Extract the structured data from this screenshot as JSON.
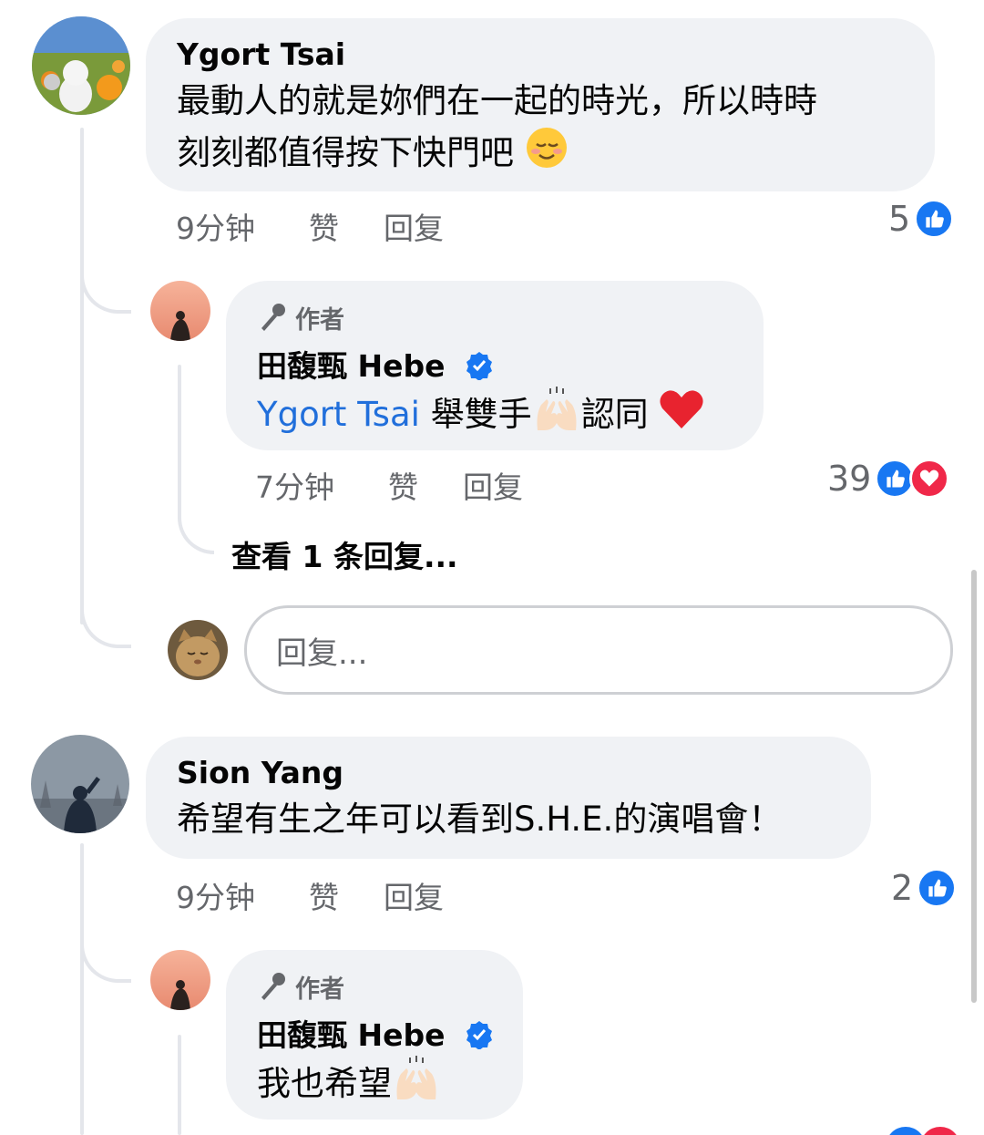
{
  "comments": [
    {
      "name": "Ygort Tsai",
      "text_line1": "最動人的就是妳們在一起的時光，所以時時",
      "text_line2": "刻刻都值得按下快門吧",
      "time": "9分钟",
      "like_label": "赞",
      "reply_label": "回复",
      "reaction_count": "5",
      "reply": {
        "author_tag": "作者",
        "name": "田馥甄 Hebe",
        "mention": "Ygort Tsai",
        "text": "舉雙手",
        "text_after": "認同",
        "time": "7分钟",
        "like_label": "赞",
        "reply_label": "回复",
        "reaction_count": "39"
      },
      "view_replies": "查看 1 条回复...",
      "reply_placeholder": "回复..."
    },
    {
      "name": "Sion Yang",
      "text": "希望有生之年可以看到S.H.E.的演唱會！",
      "time": "9分钟",
      "like_label": "赞",
      "reply_label": "回复",
      "reaction_count": "2",
      "reply": {
        "author_tag": "作者",
        "name": "田馥甄 Hebe",
        "text": "我也希望"
      }
    }
  ],
  "colors": {
    "like": "#1877f2",
    "love": "#f02849",
    "mention": "#216fdb",
    "bubble": "#f0f2f5"
  }
}
